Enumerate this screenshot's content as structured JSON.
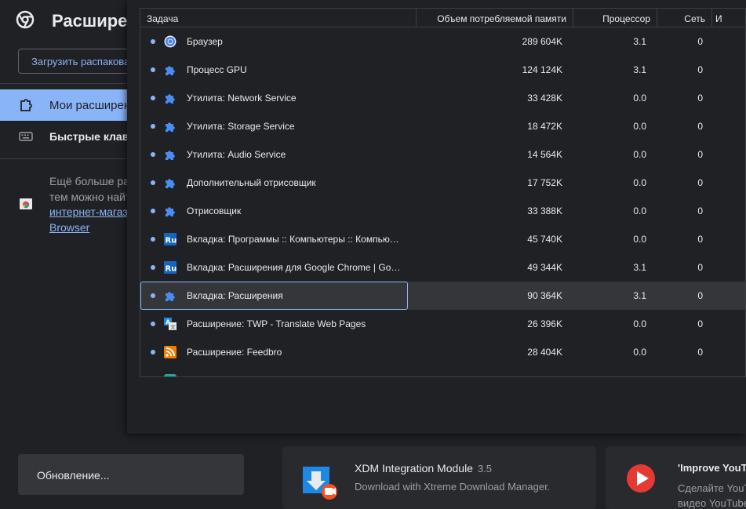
{
  "page": {
    "title": "Расширения",
    "load_unpacked_label": "Загрузить распакованное расширение",
    "sidebar": [
      {
        "label": "Мои расширения",
        "icon": "puzzle-outline-icon"
      },
      {
        "label": "Быстрые клавиши",
        "icon": "keyboard-icon"
      }
    ],
    "promo_text_line1": "Ещё больше расширений",
    "promo_text_line2": "тем можно найти в",
    "promo_link_1": "интернет-магазине",
    "promo_link_2": "Browser",
    "update_label": "Обновление...",
    "cards": [
      {
        "name": "XDM Integration Module",
        "version": "3.5",
        "description": "Download with Xtreme Download Manager.",
        "icon": "xdm-download-icon"
      },
      {
        "name": "'Improve YouTube",
        "version": "",
        "description_1": "Сделайте YouTube",
        "description_2": "видео YouTube",
        "icon": "youtube-play-icon"
      }
    ]
  },
  "task_manager": {
    "columns": {
      "task": "Задача",
      "memory": "Объем потребляемой памяти",
      "cpu": "Процессор",
      "network": "Сеть",
      "pid": "И"
    },
    "rows": [
      {
        "name": "Браузер",
        "memory": "289 604K",
        "cpu": "3.1",
        "network": "0",
        "icon": "chrome-icon"
      },
      {
        "name": "Процесс GPU",
        "memory": "124 124K",
        "cpu": "3.1",
        "network": "0",
        "icon": "puzzle-icon"
      },
      {
        "name": "Утилита: Network Service",
        "memory": "33 428K",
        "cpu": "0.0",
        "network": "0",
        "icon": "puzzle-icon"
      },
      {
        "name": "Утилита: Storage Service",
        "memory": "18 472K",
        "cpu": "0.0",
        "network": "0",
        "icon": "puzzle-icon"
      },
      {
        "name": "Утилита: Audio Service",
        "memory": "14 564K",
        "cpu": "0.0",
        "network": "0",
        "icon": "puzzle-icon"
      },
      {
        "name": "Дополнительный отрисовщик",
        "memory": "17 752K",
        "cpu": "0.0",
        "network": "0",
        "icon": "puzzle-icon"
      },
      {
        "name": "Отрисовщик",
        "memory": "33 388K",
        "cpu": "0.0",
        "network": "0",
        "icon": "puzzle-icon"
      },
      {
        "name": "Вкладка: Программы :: Компьютеры :: Компьютерная литература",
        "memory": "45 740K",
        "cpu": "0.0",
        "network": "0",
        "icon": "ru-favicon-icon"
      },
      {
        "name": "Вкладка: Расширения для Google Chrome | Google",
        "memory": "49 344K",
        "cpu": "3.1",
        "network": "0",
        "icon": "ru-favicon-icon"
      },
      {
        "name": "Вкладка: Расширения",
        "memory": "90 364K",
        "cpu": "3.1",
        "network": "0",
        "icon": "puzzle-icon",
        "selected": true
      },
      {
        "name": "Расширение: TWP - Translate Web Pages",
        "memory": "26 396K",
        "cpu": "0.0",
        "network": "0",
        "icon": "translate-icon"
      },
      {
        "name": "Расширение: Feedbro",
        "memory": "28 404K",
        "cpu": "0.0",
        "network": "0",
        "icon": "rss-icon"
      }
    ]
  },
  "colors": {
    "accent": "#8ab4f8",
    "background": "#202124",
    "selected_row": "#35363a"
  }
}
